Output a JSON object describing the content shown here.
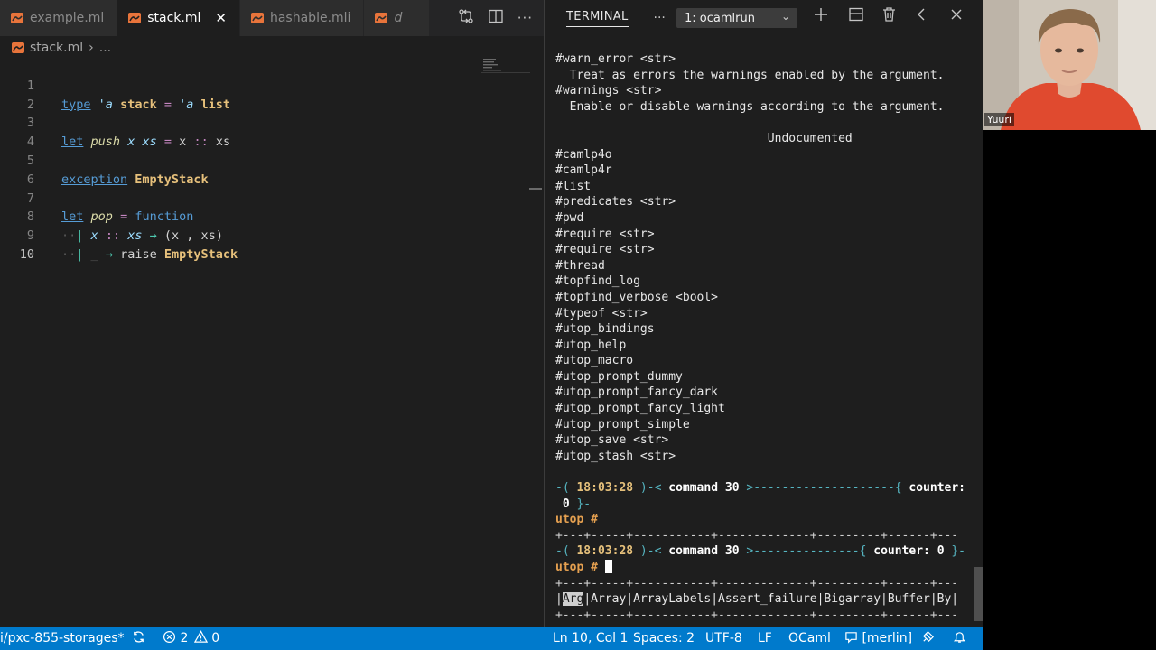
{
  "editor": {
    "tabs": [
      {
        "label": "example.ml",
        "active": false
      },
      {
        "label": "stack.ml",
        "active": true
      },
      {
        "label": "hashable.mli",
        "active": false
      },
      {
        "label": "d",
        "active": false
      }
    ],
    "close_glyph": "✕",
    "breadcrumb": {
      "file": "stack.ml",
      "sep": "›",
      "rest": "..."
    },
    "current_line": 10,
    "line_numbers": [
      "1",
      "2",
      "3",
      "4",
      "5",
      "6",
      "7",
      "8",
      "9",
      "10"
    ],
    "code": {
      "l1": {
        "kw": "type",
        "tvar": "'a",
        "name": "stack",
        "eq": "=",
        "tvar2": "'a",
        "ty": "list"
      },
      "l3": {
        "kw": "let",
        "fn": "push",
        "a": "x",
        "b": "xs",
        "eq": "=",
        "body1": "x",
        "cons": "::",
        "body2": "xs"
      },
      "l5": {
        "kw": "exception",
        "name": "EmptyStack"
      },
      "l7": {
        "kw": "let",
        "fn": "pop",
        "eq": "=",
        "kw2": "function"
      },
      "l8": {
        "bar": "|",
        "a": "x",
        "cons": "::",
        "b": "xs",
        "arrow": "→",
        "tuple": "(x , xs)"
      },
      "l9": {
        "bar": "|",
        "wild": "_",
        "arrow": "→",
        "raise": "raise",
        "exc": "EmptyStack"
      }
    }
  },
  "terminal": {
    "title": "TERMINAL",
    "more": "···",
    "selected_shell": "1: ocamlrun",
    "lines": [
      "#warn_error <str>",
      "  Treat as errors the warnings enabled by the argument.",
      "#warnings <str>",
      "  Enable or disable warnings according to the argument.",
      "",
      "                              Undocumented",
      "#camlp4o",
      "#camlp4r",
      "#list",
      "#predicates <str>",
      "#pwd",
      "#require <str>",
      "#require <str>",
      "#thread",
      "#topfind_log",
      "#topfind_verbose <bool>",
      "#typeof <str>",
      "#utop_bindings",
      "#utop_help",
      "#utop_macro",
      "#utop_prompt_dummy",
      "#utop_prompt_fancy_dark",
      "#utop_prompt_fancy_light",
      "#utop_prompt_simple",
      "#utop_save <str>",
      "#utop_stash <str>"
    ],
    "prompt1": {
      "time": "18:03:28",
      "cmd": "command 30",
      "dashes": "--------------------",
      "counter_label": "counter:",
      "counter": "0"
    },
    "prompt2": {
      "time": "18:03:28",
      "cmd": "command 30",
      "dashes": "---------------",
      "counter_label": "counter:",
      "counter": "0"
    },
    "utop_prompt": "utop #",
    "border": "+---+-----+-----------+-------------+---------+------+---",
    "completion_selected": "Arg",
    "completion_rest": "|Array|ArrayLabels|Assert_failure|Bigarray|Buffer|By|"
  },
  "webcam": {
    "name": "Yuuri"
  },
  "statusbar": {
    "branch": "i/pxc-855-storages*",
    "errors": "2",
    "warnings": "0",
    "position": "Ln 10, Col 1",
    "spaces": "Spaces: 2",
    "encoding": "UTF-8",
    "eol": "LF",
    "language": "OCaml",
    "merlin": "[merlin]"
  },
  "colors": {
    "statusbar": "#007acc",
    "accent_ocaml_icon": "#e8743b"
  }
}
